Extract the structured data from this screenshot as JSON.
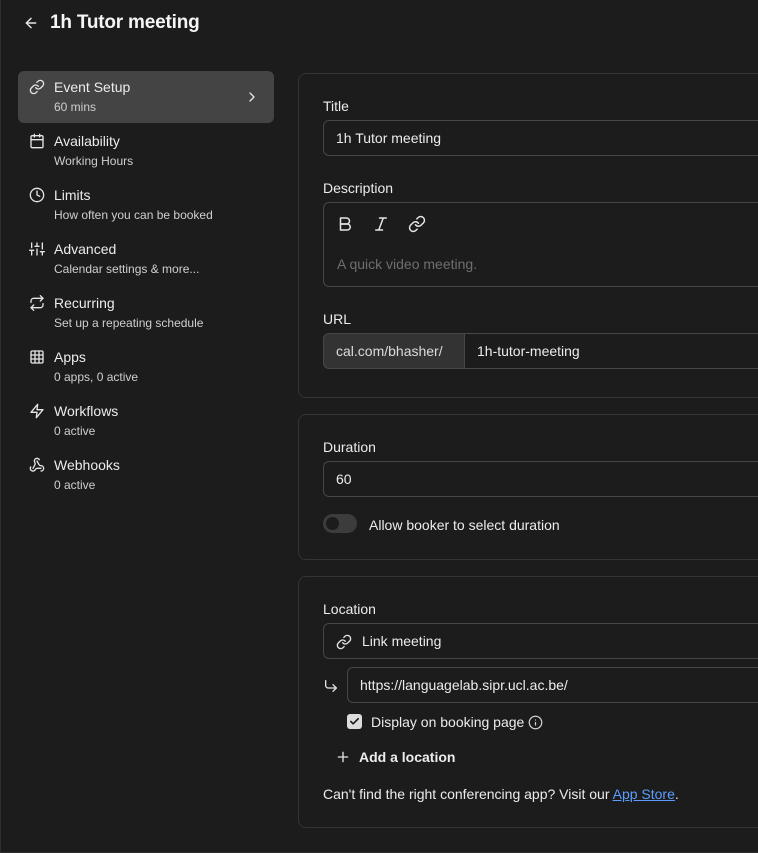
{
  "header": {
    "title": "1h Tutor meeting"
  },
  "sidebar": {
    "items": [
      {
        "label": "Event Setup",
        "sub": "60 mins"
      },
      {
        "label": "Availability",
        "sub": "Working Hours"
      },
      {
        "label": "Limits",
        "sub": "How often you can be booked"
      },
      {
        "label": "Advanced",
        "sub": "Calendar settings & more..."
      },
      {
        "label": "Recurring",
        "sub": "Set up a repeating schedule"
      },
      {
        "label": "Apps",
        "sub": "0 apps, 0 active"
      },
      {
        "label": "Workflows",
        "sub": "0 active"
      },
      {
        "label": "Webhooks",
        "sub": "0 active"
      }
    ]
  },
  "details": {
    "title_label": "Title",
    "title_value": "1h Tutor meeting",
    "description_label": "Description",
    "description_placeholder": "A quick video meeting.",
    "url_label": "URL",
    "url_prefix": "cal.com/bhasher/",
    "url_slug": "1h-tutor-meeting"
  },
  "duration": {
    "label": "Duration",
    "value": "60",
    "toggle_label": "Allow booker to select duration",
    "toggle_on": false
  },
  "location": {
    "label": "Location",
    "type": "Link meeting",
    "link_value": "https://languagelab.sipr.ucl.ac.be/",
    "display_label": "Display on booking page",
    "display_checked": true,
    "add_label": "Add a location",
    "help_text": "Can't find the right conferencing app? Visit our",
    "help_link": "App Store",
    "help_end": "."
  },
  "icons": [
    "arrow-left-icon",
    "link-icon",
    "calendar-icon",
    "clock-icon",
    "sliders-icon",
    "repeat-icon",
    "grid-icon",
    "zap-icon",
    "webhook-icon",
    "chevron-right-icon",
    "bold-icon",
    "italic-icon",
    "corner-down-right-icon",
    "check-icon",
    "info-icon",
    "plus-icon"
  ]
}
